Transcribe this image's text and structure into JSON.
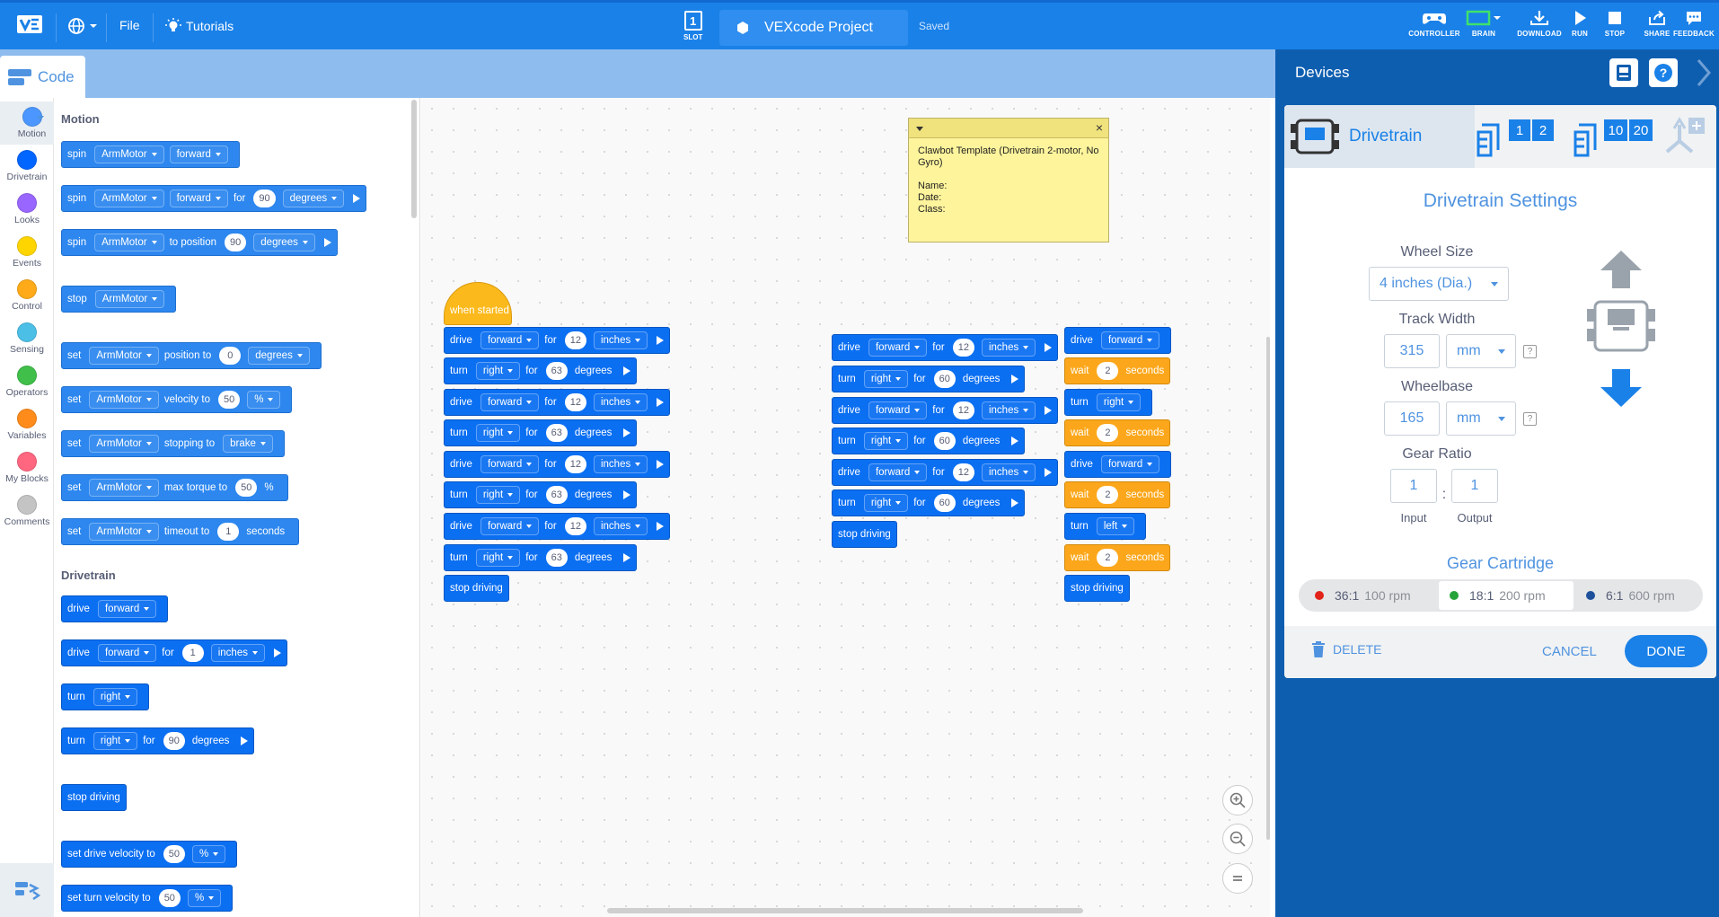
{
  "topbar": {
    "file_label": "File",
    "tutorials_label": "Tutorials",
    "slot_label": "SLOT",
    "slot_number": "1",
    "project_name": "VEXcode Project",
    "save_status": "Saved",
    "controller_label": "CONTROLLER",
    "brain_label": "BRAIN",
    "download_label": "DOWNLOAD",
    "run_label": "RUN",
    "stop_label": "STOP",
    "share_label": "SHARE",
    "feedback_label": "FEEDBACK"
  },
  "code_tab": {
    "label": "Code"
  },
  "categories": [
    {
      "label": "Motion",
      "color": "#4c97ff"
    },
    {
      "label": "Drivetrain",
      "color": "#0066ff"
    },
    {
      "label": "Looks",
      "color": "#9966ff"
    },
    {
      "label": "Events",
      "color": "#ffd500"
    },
    {
      "label": "Control",
      "color": "#ffab19"
    },
    {
      "label": "Sensing",
      "color": "#4cbfe6"
    },
    {
      "label": "Operators",
      "color": "#40bf4a"
    },
    {
      "label": "Variables",
      "color": "#ff8c1a"
    },
    {
      "label": "My Blocks",
      "color": "#ff6680"
    },
    {
      "label": "Comments",
      "color": "#c4c4c4"
    }
  ],
  "flyout": {
    "motion_heading": "Motion",
    "drivetrain_heading": "Drivetrain",
    "spin": "spin",
    "arm_motor": "ArmMotor",
    "forward": "forward",
    "for": "for",
    "degrees": "degrees",
    "to_position": "to position",
    "stop": "stop",
    "set": "set",
    "position_to": "position to",
    "velocity_to": "velocity to",
    "percent": "%",
    "stopping_to": "stopping to",
    "brake": "brake",
    "max_torque_to": "max torque to",
    "timeout_to": "timeout to",
    "seconds": "seconds",
    "drive": "drive",
    "inches": "inches",
    "turn": "turn",
    "right": "right",
    "stop_driving": "stop driving",
    "set_drive_velocity_to": "set drive velocity to",
    "set_turn_velocity_to": "set turn velocity to",
    "n90": "90",
    "n0": "0",
    "n50": "50",
    "n1": "1"
  },
  "script": {
    "when_started": "when started",
    "drive": "drive",
    "forward": "forward",
    "for": "for",
    "inches": "inches",
    "turn": "turn",
    "right": "right",
    "left": "left",
    "degrees": "degrees",
    "stop_driving": "stop driving",
    "wait": "wait",
    "seconds": "seconds",
    "n12": "12",
    "n63": "63",
    "n60": "60",
    "n2": "2"
  },
  "note": {
    "text": "Clawbot Template (Drivetrain 2-motor, No Gyro)\n\nName:\nDate:\nClass:"
  },
  "devices": {
    "title": "Devices",
    "device_name": "Drivetrain",
    "port_a": "1",
    "port_b": "2",
    "port_c": "10",
    "port_d": "20",
    "settings_title": "Drivetrain Settings",
    "wheel_size_label": "Wheel Size",
    "wheel_size_value": "4 inches (Dia.)",
    "track_width_label": "Track Width",
    "track_width_value": "315",
    "unit_mm": "mm",
    "wheelbase_label": "Wheelbase",
    "wheelbase_value": "165",
    "gear_ratio_label": "Gear Ratio",
    "gear_input_value": "1",
    "gear_output_value": "1",
    "ratio_sep": ":",
    "input_label": "Input",
    "output_label": "Output",
    "help_glyph": "?",
    "gear_cartridge_label": "Gear Cartridge",
    "cart1_ratio": "36:1",
    "cart1_rpm": "100 rpm",
    "cart2_ratio": "18:1",
    "cart2_rpm": "200 rpm",
    "cart3_ratio": "6:1",
    "cart3_rpm": "600 rpm",
    "delete_label": "DELETE",
    "cancel_label": "CANCEL",
    "done_label": "DONE"
  }
}
